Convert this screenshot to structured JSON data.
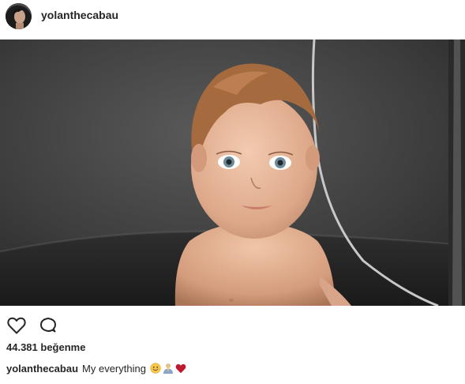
{
  "post": {
    "username": "yolanthecabau",
    "image_alt": "Toddler sitting in a dark shower with wet hair",
    "actions": {
      "like_icon": "heart-outline-icon",
      "comment_icon": "comment-bubble-icon"
    },
    "likes_text": "44.381 beğenme",
    "caption": {
      "username": "yolanthecabau",
      "text": "My everything",
      "emojis": [
        "smiling-face-emoji",
        "person-praying-emoji",
        "red-heart-emoji"
      ]
    }
  },
  "colors": {
    "text": "#262626",
    "background": "#ffffff",
    "heart_red": "#be1931"
  }
}
